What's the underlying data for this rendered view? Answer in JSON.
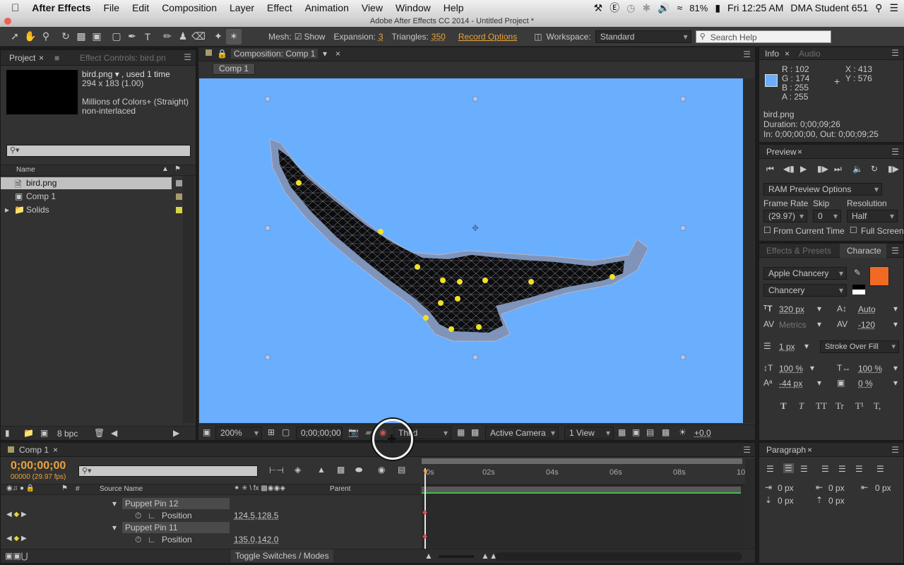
{
  "menubar": {
    "app": "After Effects",
    "items": [
      "File",
      "Edit",
      "Composition",
      "Layer",
      "Effect",
      "Animation",
      "View",
      "Window",
      "Help"
    ],
    "battery": "81%",
    "clock": "Fri 12:25 AM",
    "user": "DMA Student 651"
  },
  "window": {
    "title": "Adobe After Effects CC 2014 - Untitled Project *"
  },
  "toolbar": {
    "mesh_label": "Mesh:",
    "show_label": "Show",
    "expansion_label": "Expansion:",
    "expansion_value": "3",
    "triangles_label": "Triangles:",
    "triangles_value": "350",
    "record_options": "Record Options",
    "workspace_label": "Workspace:",
    "workspace_value": "Standard",
    "search_placeholder": "Search Help"
  },
  "project": {
    "tab": "Project",
    "tab2": "Effect Controls: bird.pn",
    "file_name": "bird.png ▾ , used 1 time",
    "dims": "294 x 183 (1.00)",
    "colors": "Millions of Colors+ (Straight)",
    "interlace": "non-interlaced",
    "col_name": "Name",
    "items": [
      {
        "name": "bird.png"
      },
      {
        "name": "Comp 1"
      },
      {
        "name": "Solids"
      }
    ],
    "bpc": "8 bpc"
  },
  "comp": {
    "tab": "Composition: Comp 1",
    "breadcrumb": "Comp 1",
    "zoom": "200%",
    "timecode": "0;00;00;00",
    "resolution": "Third",
    "camera": "Active Camera",
    "views": "1 View",
    "exposure": "+0.0"
  },
  "info": {
    "tab": "Info",
    "tab2": "Audio",
    "r": "R : 102",
    "g": "G : 174",
    "b": "B : 255",
    "a": "A : 255",
    "x": "X : 413",
    "y": "Y : 576",
    "name": "bird.png",
    "duration": "Duration: 0;00;09;26",
    "inout": "In: 0;00;00;00, Out: 0;00;09;25",
    "swatch": "#6aaefe"
  },
  "preview": {
    "tab": "Preview",
    "options": "RAM Preview Options",
    "frame_rate_label": "Frame Rate",
    "skip_label": "Skip",
    "resolution_label": "Resolution",
    "frame_rate": "(29.97)",
    "skip": "0",
    "resolution": "Half",
    "from_current": "From Current Time",
    "full_screen": "Full Screen"
  },
  "character": {
    "tab1": "Effects & Presets",
    "tab2": "Characte",
    "font": "Apple Chancery",
    "style": "Chancery",
    "size": "320 px",
    "leading": "Auto",
    "kerning": "Metrics",
    "tracking": "-120",
    "stroke_width": "1 px",
    "stroke_mode": "Stroke Over Fill",
    "vscale": "100 %",
    "hscale": "100 %",
    "baseline": "-44 px",
    "tsume": "0 %",
    "fill_color": "#f06a24",
    "type_buttons": [
      "T",
      "T",
      "TT",
      "Tr",
      "T¹",
      "T,"
    ]
  },
  "paragraph": {
    "tab": "Paragraph",
    "indent_left": "0 px",
    "indent_first": "0 px",
    "indent_right": "0 px",
    "space_before": "0 px",
    "space_after": "0 px"
  },
  "timeline": {
    "tab": "Comp 1",
    "timecode": "0;00;00;00",
    "fps": "00000 (29.97 fps)",
    "col_source": "Source Name",
    "col_parent": "Parent",
    "ticks": [
      "0s",
      "02s",
      "04s",
      "06s",
      "08s",
      "10"
    ],
    "rows": [
      {
        "label": "Puppet Pin 12",
        "type": "pin"
      },
      {
        "label": "Position",
        "type": "prop",
        "value": "124.5,128.5"
      },
      {
        "label": "Puppet Pin 11",
        "type": "pin"
      },
      {
        "label": "Position",
        "type": "prop",
        "value": "135.0,142.0"
      }
    ],
    "toggle": "Toggle Switches / Modes"
  }
}
